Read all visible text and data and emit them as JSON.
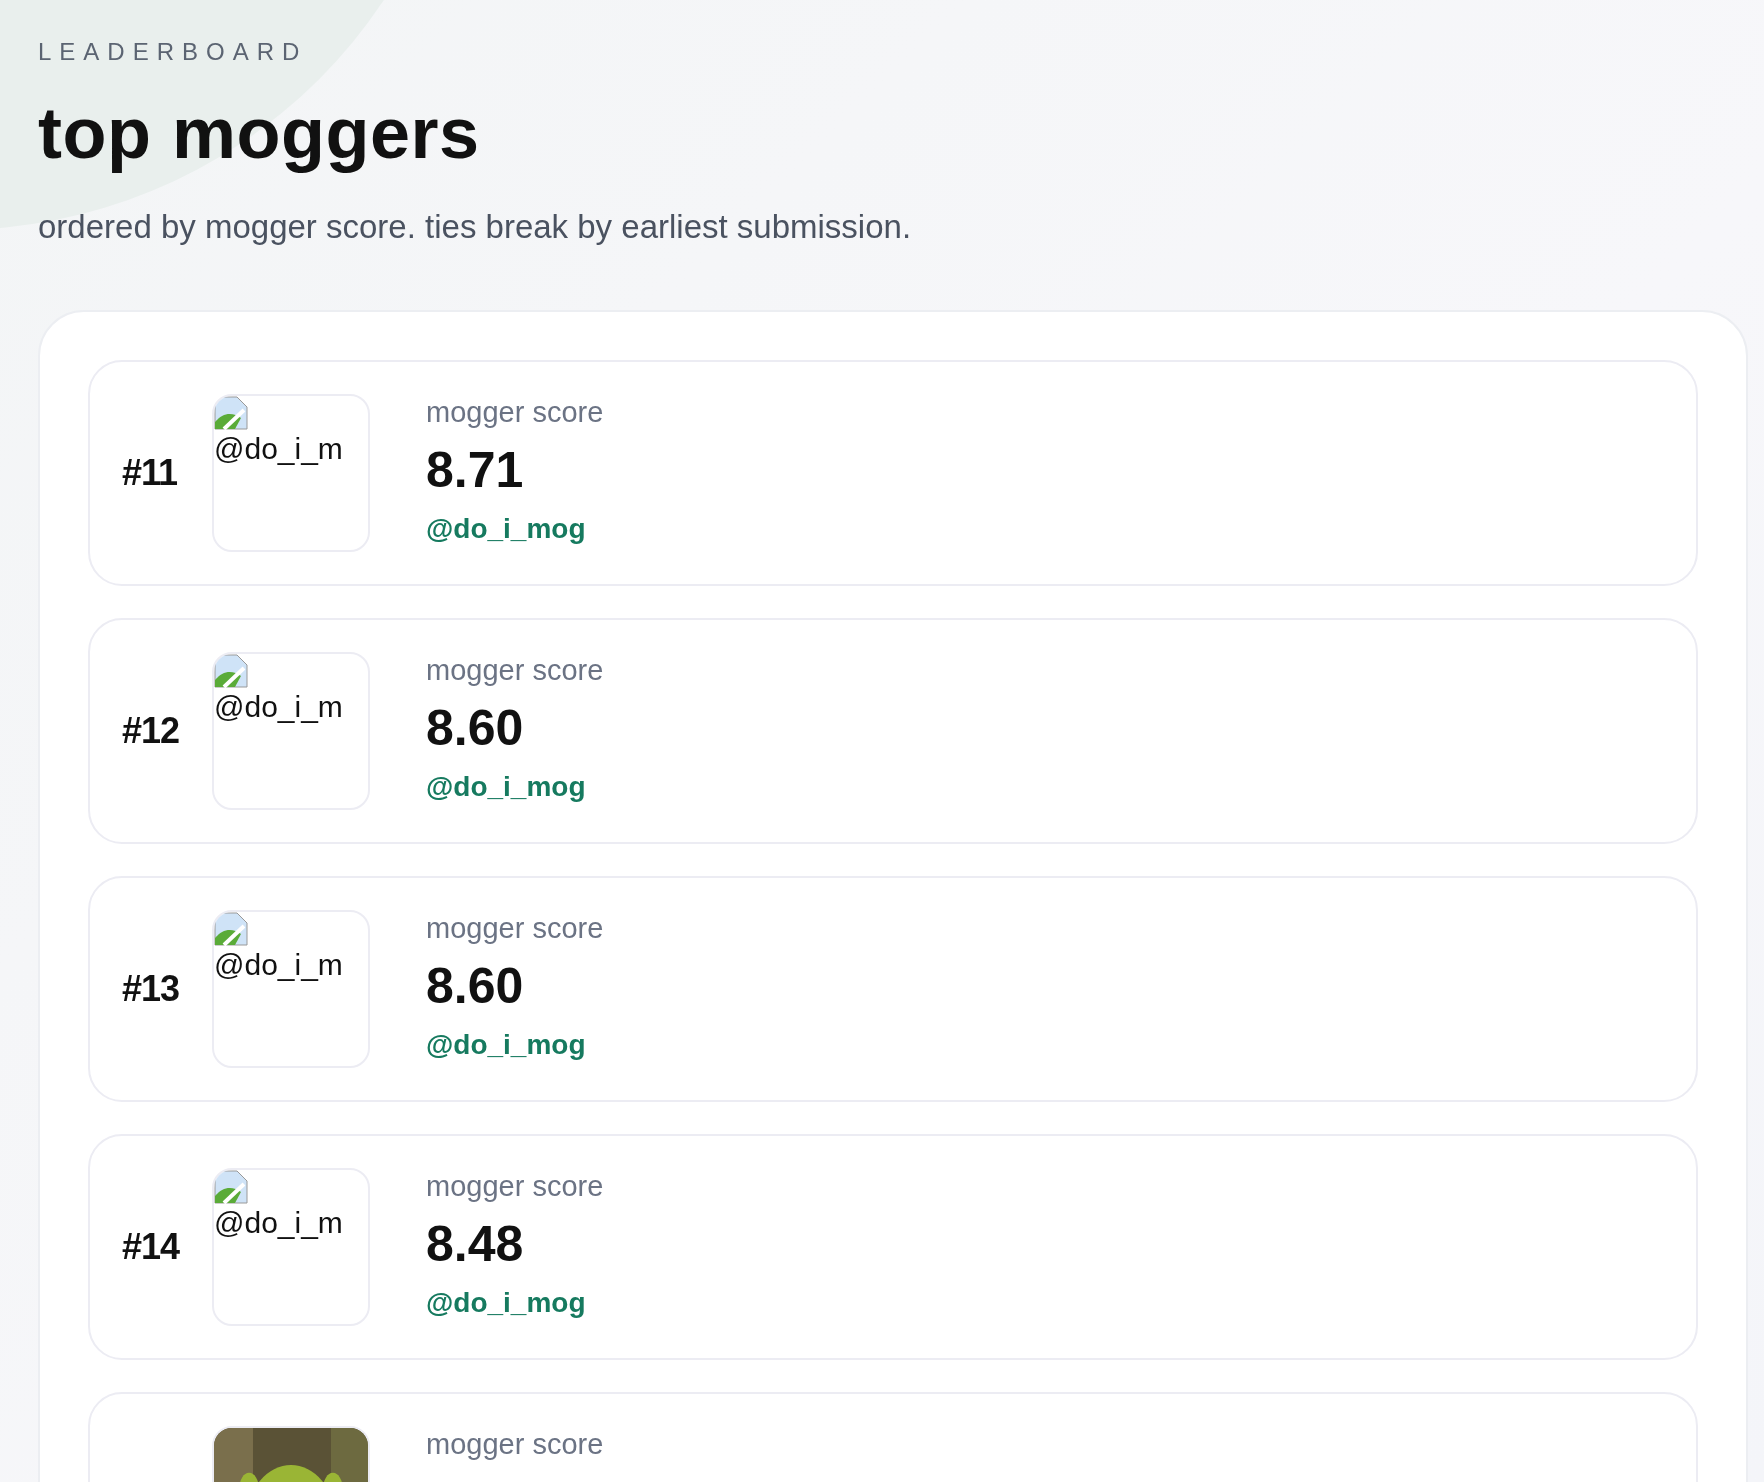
{
  "header": {
    "eyebrow": "LEADERBOARD",
    "title": "top moggers",
    "subtitle": "ordered by mogger score. ties break by earliest submission."
  },
  "entries": [
    {
      "rank": "#11",
      "avatar": {
        "kind": "broken",
        "alt": "@do_i_m"
      },
      "score_label": "mogger score",
      "score": "8.71",
      "handle": "@do_i_mog"
    },
    {
      "rank": "#12",
      "avatar": {
        "kind": "broken",
        "alt": "@do_i_m"
      },
      "score_label": "mogger score",
      "score": "8.60",
      "handle": "@do_i_mog"
    },
    {
      "rank": "#13",
      "avatar": {
        "kind": "broken",
        "alt": "@do_i_m"
      },
      "score_label": "mogger score",
      "score": "8.60",
      "handle": "@do_i_mog"
    },
    {
      "rank": "#14",
      "avatar": {
        "kind": "broken",
        "alt": "@do_i_m"
      },
      "score_label": "mogger score",
      "score": "8.48",
      "handle": "@do_i_mog"
    },
    {
      "score_label": "mogger score"
    }
  ]
}
